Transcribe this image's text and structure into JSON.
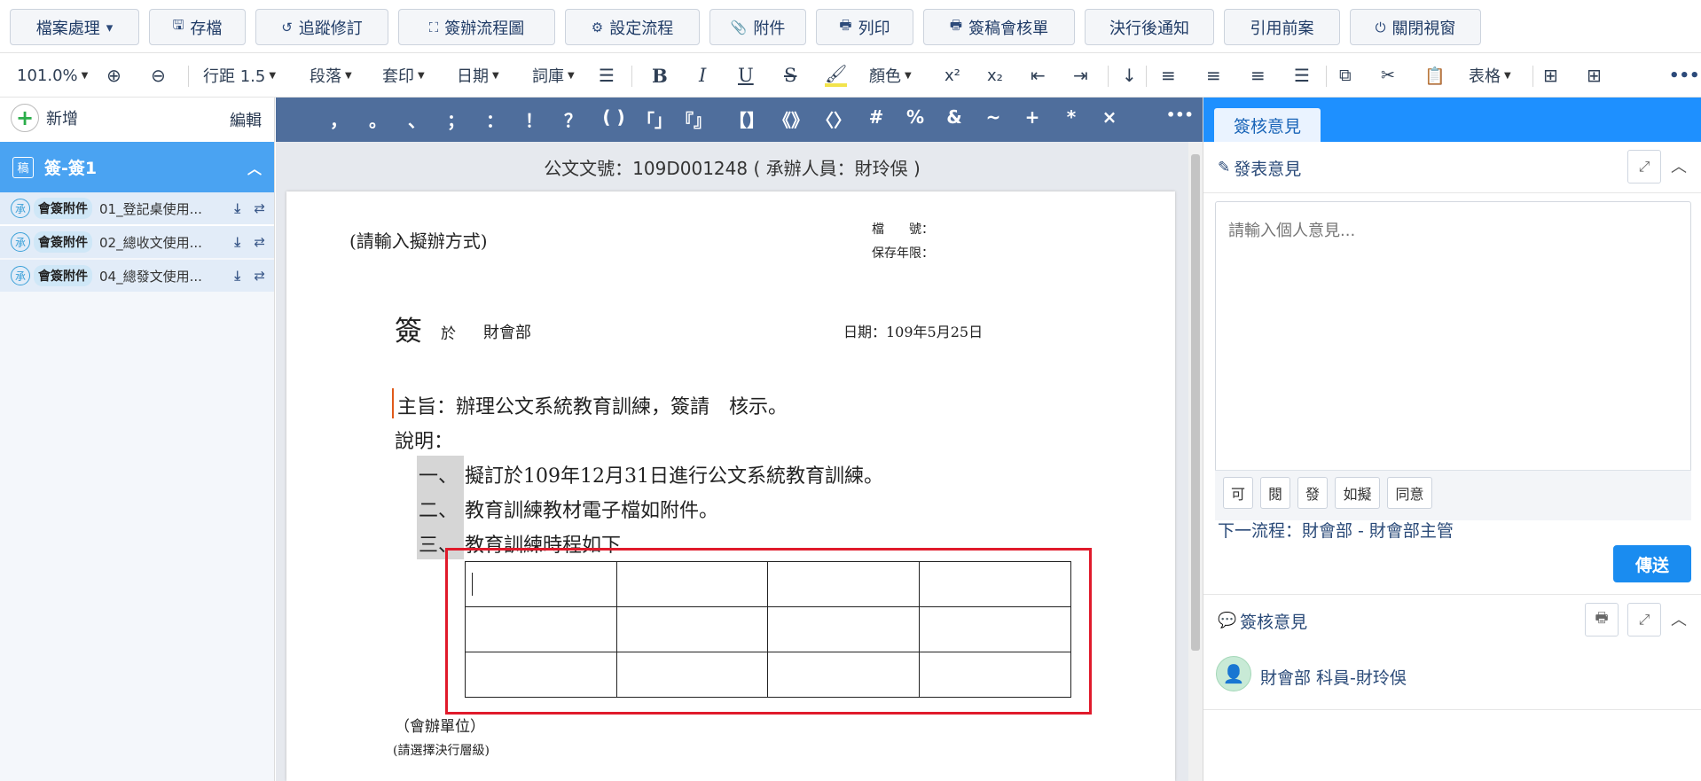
{
  "toolbar": {
    "file_menu": "檔案處理",
    "save": "存檔",
    "track": "追蹤修訂",
    "flowchart": "簽辦流程圖",
    "setflow": "設定流程",
    "attach": "附件",
    "print": "列印",
    "printsheet": "簽稿會核單",
    "notify": "決行後通知",
    "cite": "引用前案",
    "close": "關閉視窗"
  },
  "format": {
    "zoom": "101.0%",
    "linespacing": "行距 1.5",
    "paragraph": "段落",
    "stamp": "套印",
    "date": "日期",
    "lexicon": "詞庫",
    "color": "顏色",
    "table": "表格",
    "sup": "x²",
    "sub": "x₂"
  },
  "left": {
    "new_label": "新增",
    "edit_label": "編輯",
    "doc_item": "簽-簽1",
    "doc_icon_text": "稿",
    "attachments": [
      {
        "mark": "承",
        "badge": "會簽附件",
        "name": "01_登記桌使用..."
      },
      {
        "mark": "承",
        "badge": "會簽附件",
        "name": "02_總收文使用..."
      },
      {
        "mark": "承",
        "badge": "會簽附件",
        "name": "04_總發文使用..."
      }
    ]
  },
  "punct": [
    "，",
    "。",
    "、",
    "；",
    "：",
    "！",
    "？",
    "( )",
    "「」",
    "『』",
    "【】",
    "《》",
    "〈〉",
    "#",
    "%",
    "&",
    "~",
    "+",
    "*",
    "×"
  ],
  "doc": {
    "header": "公文文號：109D001248 ( 承辦人員：財玲俁 )",
    "method": "(請輸入擬辦方式)",
    "file_no": "檔　　號：",
    "retention": "保存年限：",
    "sign": "簽",
    "at": "於",
    "dept": "財會部",
    "date": "日期：109年5月25日",
    "subject": "主旨：辦理公文系統教育訓練，簽請　核示。",
    "explain": "說明：",
    "item1_no": "一、",
    "item1": "擬訂於109年12月31日進行公文系統教育訓練。",
    "item2_no": "二、",
    "item2": "教育訓練教材電子檔如附件。",
    "item3_no": "三、",
    "item3": "教育訓練時程如下",
    "cosign": "（會辦單位）",
    "level": "(請選擇決行層級)"
  },
  "right": {
    "tab": "簽核意見",
    "post_title": "發表意見",
    "placeholder": "請輸入個人意見...",
    "quick": [
      "可",
      "閱",
      "發",
      "如擬",
      "同意"
    ],
    "next_flow": "下一流程：財會部 - 財會部主管",
    "send": "傳送",
    "review_title": "簽核意見",
    "reviewer": "財會部 科員-財玲俁"
  }
}
